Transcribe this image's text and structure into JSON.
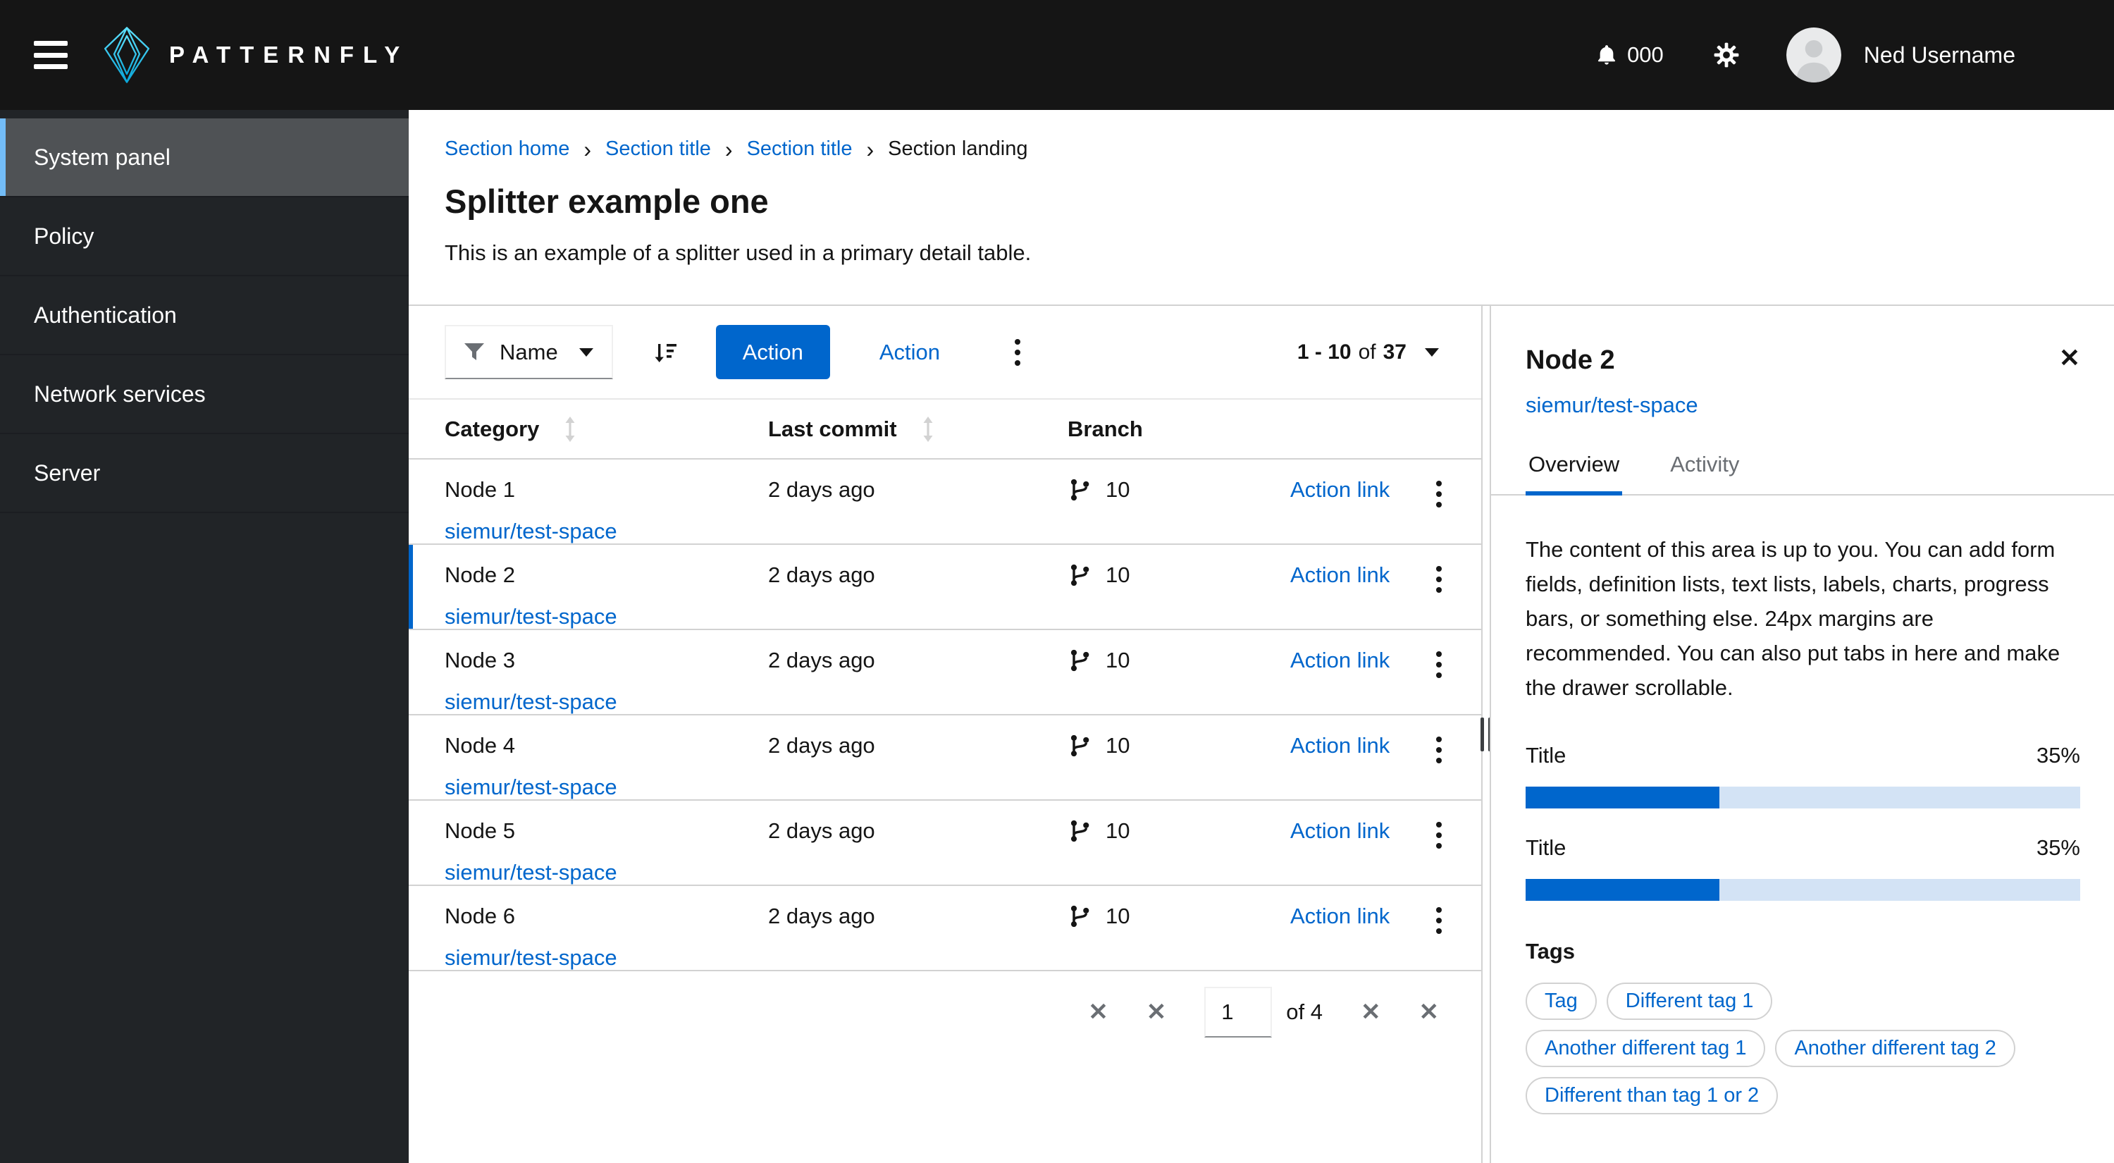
{
  "theme": {
    "primary": "#0066cc",
    "link": "#0066cc",
    "nav_selected_border": "#73bcf7",
    "masthead_bg": "#151515",
    "sidebar_bg": "#212427",
    "progress_track": "#d3e3f5",
    "border": "#d2d2d2",
    "muted_text": "#6a6e73"
  },
  "header": {
    "brand": "PATTERNFLY",
    "notification_count": "000",
    "username": "Ned Username"
  },
  "sidebar": {
    "items": [
      {
        "label": "System panel",
        "selected": true
      },
      {
        "label": "Policy",
        "selected": false
      },
      {
        "label": "Authentication",
        "selected": false
      },
      {
        "label": "Network services",
        "selected": false
      },
      {
        "label": "Server",
        "selected": false
      }
    ]
  },
  "breadcrumb": {
    "separator": "›",
    "items": [
      {
        "label": "Section home",
        "current": false
      },
      {
        "label": "Section title",
        "current": false
      },
      {
        "label": "Section title",
        "current": false
      },
      {
        "label": "Section landing",
        "current": true
      }
    ]
  },
  "page": {
    "title": "Splitter example one",
    "description": "This is an example of a splitter used in a primary detail table."
  },
  "toolbar": {
    "filter_label": "Name",
    "primary_action": "Action",
    "secondary_action": "Action",
    "pagination": {
      "range": "1 - 10",
      "of_label": "of",
      "total": "37"
    }
  },
  "table": {
    "columns": [
      "Category",
      "Last commit",
      "Branch"
    ],
    "rows": [
      {
        "name": "Node 1",
        "workspace": "siemur/test-space",
        "last_commit": "2 days ago",
        "branches": "10",
        "action": "Action link",
        "selected": false
      },
      {
        "name": "Node 2",
        "workspace": "siemur/test-space",
        "last_commit": "2 days ago",
        "branches": "10",
        "action": "Action link",
        "selected": true
      },
      {
        "name": "Node 3",
        "workspace": "siemur/test-space",
        "last_commit": "2 days ago",
        "branches": "10",
        "action": "Action link",
        "selected": false
      },
      {
        "name": "Node 4",
        "workspace": "siemur/test-space",
        "last_commit": "2 days ago",
        "branches": "10",
        "action": "Action link",
        "selected": false
      },
      {
        "name": "Node 5",
        "workspace": "siemur/test-space",
        "last_commit": "2 days ago",
        "branches": "10",
        "action": "Action link",
        "selected": false
      },
      {
        "name": "Node 6",
        "workspace": "siemur/test-space",
        "last_commit": "2 days ago",
        "branches": "10",
        "action": "Action link",
        "selected": false
      }
    ]
  },
  "pagination": {
    "first_glyph": "✕",
    "prev_glyph": "✕",
    "page": "1",
    "of_label": "of 4",
    "next_glyph": "✕",
    "last_glyph": "✕"
  },
  "drawer": {
    "title": "Node 2",
    "workspace": "siemur/test-space",
    "close_glyph": "✕",
    "tabs": [
      {
        "label": "Overview",
        "active": true
      },
      {
        "label": "Activity",
        "active": false
      }
    ],
    "body": "The content of this area is up to you. You can add form fields, definition lists, text lists, labels, charts, progress bars, or something else. 24px margins are recommended. You can also put tabs in here and make the drawer scrollable.",
    "progress": [
      {
        "label": "Title",
        "value": "35%",
        "percent": 35
      },
      {
        "label": "Title",
        "value": "35%",
        "percent": 35
      }
    ],
    "tags_label": "Tags",
    "tags": [
      "Tag",
      "Different tag 1",
      "Another different tag 1",
      "Another different tag 2",
      "Different than tag 1 or 2"
    ]
  }
}
